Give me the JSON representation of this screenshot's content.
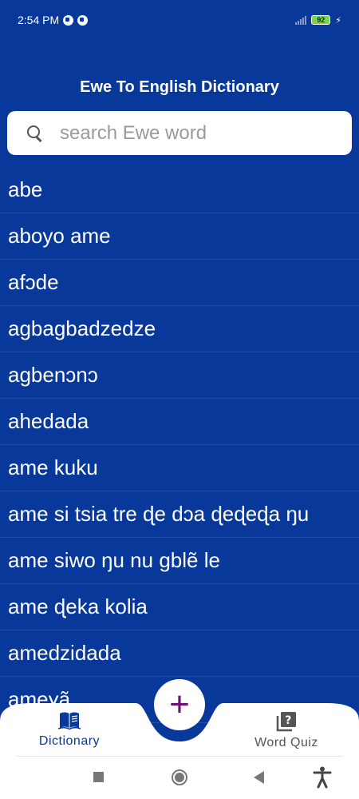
{
  "status_bar": {
    "time": "2:54 PM",
    "battery": "92"
  },
  "header": {
    "title": "Ewe To English Dictionary"
  },
  "search": {
    "placeholder": "search Ewe word"
  },
  "words": [
    "abe",
    "aboyo ame",
    "afɔde",
    "agbagbadzedze",
    "agbenɔnɔ",
    "ahedada",
    "ame kuku",
    "ame si tsia tre ɖe dɔa ɖeɖeɖa ŋu",
    "ame siwo ŋu nu gblẽ le",
    "ame ɖeka kolia",
    "amedzidada",
    "ameɣã"
  ],
  "bottom_nav": {
    "dictionary_label": "Dictionary",
    "quiz_label": "Word Quiz",
    "fab_symbol": "+"
  },
  "colors": {
    "background": "#08389a",
    "accent": "#6a1070"
  }
}
